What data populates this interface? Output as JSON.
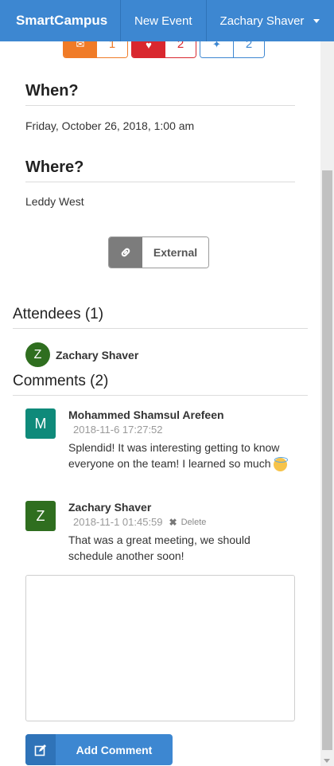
{
  "nav": {
    "brand": "SmartCampus",
    "new_event": "New Event",
    "user": "Zachary Shaver"
  },
  "votes": [
    {
      "icon": "envelope-icon",
      "count": "1",
      "color": "#f07b27"
    },
    {
      "icon": "heart-icon",
      "count": "2",
      "color": "#d9272e"
    },
    {
      "icon": "thumbs-icon",
      "count": "2",
      "color": "#3d87d1"
    }
  ],
  "when": {
    "heading": "When?",
    "value": "Friday, October 26, 2018, 1:00 am"
  },
  "where": {
    "heading": "Where?",
    "value": "Leddy West"
  },
  "external_button": {
    "label": "External"
  },
  "attendees": {
    "heading": "Attendees (1)",
    "list": [
      {
        "initial": "Z",
        "name": "Zachary Shaver"
      }
    ]
  },
  "comments": {
    "heading": "Comments (2)",
    "list": [
      {
        "initial": "M",
        "color": "#0f8a7a",
        "author": "Mohammed Shamsul Arefeen",
        "timestamp": "2018-11-6 17:27:52",
        "text": "Splendid! It was interesting getting to know everyone on the team! I learned so much"
      },
      {
        "initial": "Z",
        "color": "#2f6e1f",
        "author": "Zachary Shaver",
        "timestamp": "2018-11-1 01:45:59",
        "delete_label": "Delete",
        "text": "That was a great meeting, we should schedule another soon!"
      }
    ]
  },
  "comment_input": {
    "placeholder": ""
  },
  "add_comment": {
    "label": "Add Comment"
  }
}
